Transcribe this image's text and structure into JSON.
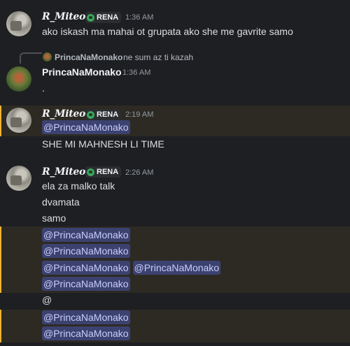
{
  "colors": {
    "background": "#1e1f22",
    "mention_highlight": "#2d2a24",
    "mention_bar": "#f0b232",
    "mention_pill": "#3c4270",
    "mention_pill_text": "#c9cdfb",
    "role_tag_dot": "#3ba55c"
  },
  "messages": [
    {
      "author": "R_Miteo",
      "tag": "RENA",
      "time": "1:36 AM",
      "lines": [
        "ako iskash ma mahai ot grupata ako she me gavrite samo"
      ]
    },
    {
      "reply_to": {
        "author": "PrincaNaMonako",
        "text": "ne sum az ti kazah"
      },
      "author": "PrincaNaMonako",
      "time": "1:36 AM",
      "lines": [
        "."
      ]
    },
    {
      "author": "R_Miteo",
      "tag": "RENA",
      "time": "2:19 AM",
      "mention": "@PrincaNaMonako",
      "lines": [
        "SHE MI MAHNESH LI TIME"
      ]
    },
    {
      "author": "R_Miteo",
      "tag": "RENA",
      "time": "2:26 AM",
      "lines": [
        "ela za malko talk",
        "dvamata",
        "samo"
      ],
      "mention_lines": [
        [
          "@PrincaNaMonako"
        ],
        [
          "@PrincaNaMonako"
        ],
        [
          "@PrincaNaMonako",
          "@PrincaNaMonako"
        ],
        [
          "@PrincaNaMonako"
        ]
      ],
      "plain_at": "@",
      "final_mentions": [
        [
          "@PrincaNaMonako"
        ],
        [
          "@PrincaNaMonako"
        ]
      ]
    }
  ],
  "icons": {
    "role_tag": "alien-face-icon",
    "reply": "reply-thread-icon"
  }
}
